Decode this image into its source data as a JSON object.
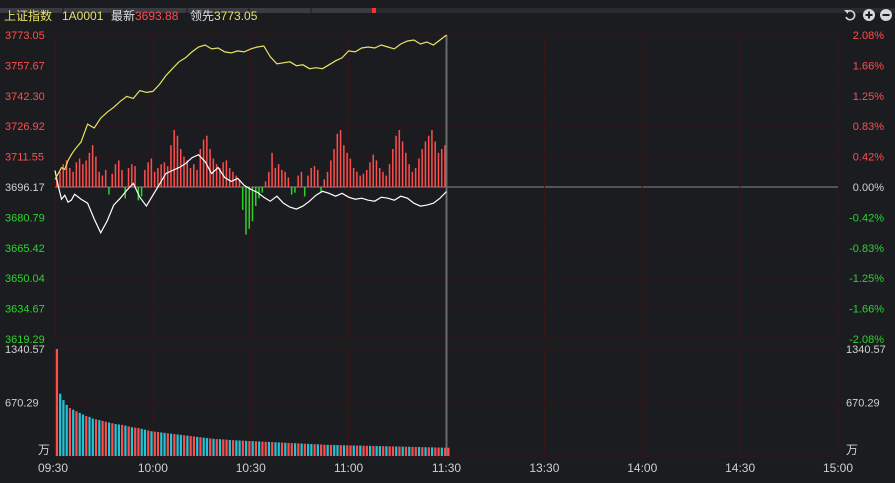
{
  "header": {
    "index_name": "上证指数",
    "code": "1A0001",
    "latest_label": "最新",
    "latest_value": "3693.88",
    "leading_label": "领先",
    "leading_value": "3773.05",
    "icons": [
      "undo-icon",
      "zoom-in-icon",
      "zoom-out-icon"
    ]
  },
  "colors": {
    "background": "#1b1c20",
    "grid": "#3a1414",
    "up": "#ff4d4d",
    "down": "#2bd42b",
    "index_line": "#ffffff",
    "leading_line": "#e9e265",
    "volume_bar": "#22c4d6",
    "axis_text_neutral": "#d0d0d0",
    "cursor_line": "#6a6a6a"
  },
  "chart_data": {
    "type": "line",
    "title": "",
    "prev_close": 3696.17,
    "ylim": [
      3619.29,
      3773.05
    ],
    "price_ticks": [
      "3773.05",
      "3757.67",
      "3742.30",
      "3726.92",
      "3711.55",
      "3696.17",
      "3680.79",
      "3665.42",
      "3650.04",
      "3634.67",
      "3619.29"
    ],
    "pct_ticks": [
      "2.08%",
      "1.66%",
      "1.25%",
      "0.83%",
      "0.42%",
      "0.00%",
      "-0.42%",
      "-0.83%",
      "-1.25%",
      "-1.66%",
      "-2.08%"
    ],
    "time_labels": [
      "09:30",
      "10:00",
      "10:30",
      "11:00",
      "11:30",
      "13:30",
      "14:00",
      "14:30",
      "15:00"
    ],
    "volume_ticks": [
      "1340.57",
      "670.29"
    ],
    "volume_unit": "万",
    "volume_max": 1340.57,
    "series": [
      {
        "key": "index",
        "x_minutes": [
          0,
          1,
          2,
          3,
          4,
          5,
          6,
          8,
          10,
          12,
          14,
          16,
          18,
          20,
          22,
          24,
          26,
          28,
          30,
          32,
          34,
          36,
          38,
          40,
          42,
          44,
          46,
          48,
          50,
          52,
          54,
          56,
          58,
          60,
          62,
          64,
          66,
          68,
          70,
          72,
          74,
          76,
          78,
          80,
          82,
          84,
          86,
          88,
          90,
          92,
          94,
          96,
          98,
          100,
          102,
          104,
          106,
          108,
          110,
          112,
          114,
          116,
          118,
          120
        ],
        "values": [
          3704.5,
          3696.5,
          3690.0,
          3692.0,
          3688.5,
          3689.5,
          3692.5,
          3690.0,
          3688.0,
          3680.0,
          3673.0,
          3679.0,
          3687.0,
          3690.5,
          3694.5,
          3698.0,
          3691.0,
          3686.5,
          3692.0,
          3697.5,
          3703.0,
          3704.5,
          3706.0,
          3708.0,
          3711.0,
          3712.5,
          3709.0,
          3703.0,
          3706.0,
          3701.0,
          3699.0,
          3700.5,
          3697.0,
          3695.0,
          3693.5,
          3691.0,
          3689.0,
          3691.5,
          3688.0,
          3686.0,
          3685.0,
          3686.5,
          3689.0,
          3692.0,
          3694.0,
          3693.0,
          3691.5,
          3693.0,
          3691.0,
          3690.0,
          3690.5,
          3689.5,
          3689.0,
          3691.0,
          3690.5,
          3689.5,
          3691.5,
          3690.5,
          3688.0,
          3686.5,
          3687.0,
          3688.0,
          3690.5,
          3693.9
        ]
      },
      {
        "key": "leading",
        "x_minutes": [
          0,
          1,
          2,
          3,
          4,
          5,
          6,
          8,
          10,
          12,
          14,
          16,
          18,
          20,
          22,
          24,
          26,
          28,
          30,
          32,
          34,
          36,
          38,
          40,
          42,
          44,
          46,
          48,
          50,
          52,
          54,
          56,
          58,
          60,
          62,
          64,
          66,
          68,
          70,
          72,
          74,
          76,
          78,
          80,
          82,
          84,
          86,
          88,
          90,
          92,
          94,
          96,
          98,
          100,
          102,
          104,
          106,
          108,
          110,
          112,
          114,
          116,
          118,
          120
        ],
        "values": [
          3700.0,
          3703.0,
          3706.0,
          3705.0,
          3709.5,
          3712.5,
          3715.0,
          3719.0,
          3728.0,
          3726.0,
          3731.0,
          3734.0,
          3736.5,
          3739.5,
          3742.0,
          3741.0,
          3745.0,
          3744.0,
          3744.5,
          3748.0,
          3752.5,
          3756.0,
          3759.5,
          3761.5,
          3764.5,
          3767.0,
          3768.0,
          3766.0,
          3766.5,
          3764.5,
          3764.0,
          3765.0,
          3764.5,
          3766.0,
          3767.0,
          3767.5,
          3762.0,
          3758.5,
          3759.0,
          3759.5,
          3757.5,
          3758.0,
          3756.0,
          3756.5,
          3756.0,
          3758.0,
          3760.0,
          3761.5,
          3765.0,
          3764.5,
          3766.5,
          3767.0,
          3766.5,
          3768.0,
          3767.0,
          3766.0,
          3768.5,
          3770.0,
          3770.5,
          3768.5,
          3769.5,
          3768.0,
          3770.5,
          3773.05
        ]
      }
    ],
    "diff_bars": [
      4,
      8,
      12,
      14,
      10,
      8,
      13,
      15,
      12,
      14,
      18,
      22,
      16,
      8,
      6,
      9,
      -4,
      7,
      12,
      14,
      9,
      -6,
      10,
      12,
      11,
      -7,
      -5,
      9,
      13,
      15,
      8,
      10,
      12,
      13,
      11,
      22,
      30,
      27,
      20,
      16,
      14,
      10,
      12,
      9,
      20,
      25,
      27,
      20,
      15,
      12,
      10,
      13,
      14,
      10,
      8,
      6,
      4,
      -12,
      -25,
      -22,
      -18,
      -10,
      -6,
      -3,
      3,
      8,
      18,
      10,
      12,
      9,
      8,
      5,
      -4,
      -3,
      6,
      8,
      -5,
      6,
      10,
      11,
      9,
      -3,
      4,
      8,
      14,
      20,
      28,
      30,
      22,
      18,
      15,
      10,
      8,
      6,
      7,
      9,
      13,
      17,
      14,
      10,
      8,
      6,
      12,
      20,
      27,
      30,
      24,
      18,
      12,
      8,
      10,
      15,
      20,
      24,
      27,
      30,
      24,
      18,
      20,
      22
    ],
    "volume": [
      1340.57,
      780,
      700,
      640,
      600,
      580,
      560,
      540,
      520,
      500,
      490,
      470,
      460,
      450,
      440,
      430,
      420,
      410,
      400,
      395,
      390,
      380,
      370,
      360,
      355,
      350,
      340,
      330,
      320,
      310,
      305,
      300,
      295,
      290,
      285,
      280,
      275,
      270,
      265,
      260,
      255,
      250,
      245,
      240,
      235,
      230,
      225,
      220,
      215,
      212,
      210,
      208,
      205,
      200,
      198,
      196,
      194,
      192,
      190,
      188,
      186,
      184,
      182,
      180,
      178,
      176,
      174,
      172,
      170,
      168,
      166,
      164,
      162,
      160,
      158,
      156,
      154,
      152,
      150,
      148,
      146,
      144,
      142,
      140,
      139,
      138,
      137,
      136,
      135,
      134,
      133,
      132,
      131,
      130,
      129,
      128,
      127,
      126,
      125,
      124,
      123,
      122,
      121,
      120,
      119,
      118,
      117,
      116,
      115,
      114,
      113,
      112,
      111,
      110,
      109,
      108,
      107,
      106,
      105,
      104,
      104
    ],
    "volume_up": [
      true,
      false,
      false,
      false,
      true,
      false,
      true,
      false,
      false,
      true,
      false,
      false,
      true,
      false,
      true,
      true,
      false,
      true,
      false,
      false,
      true,
      false,
      true,
      false,
      true,
      true,
      false,
      false,
      true,
      false,
      true,
      true,
      false,
      false,
      true,
      false,
      true,
      false,
      false,
      true,
      false,
      true,
      true,
      false,
      true,
      false,
      false,
      true,
      false,
      true,
      false,
      true,
      true,
      false,
      true,
      false,
      false,
      true,
      false,
      true,
      false,
      true,
      false,
      true,
      true,
      false,
      true,
      false,
      false,
      true,
      false,
      true,
      true,
      false,
      true,
      false,
      true,
      false,
      false,
      true,
      false,
      true,
      true,
      false,
      true,
      false,
      false,
      true,
      false,
      true,
      true,
      false,
      true,
      false,
      true,
      true,
      false,
      true,
      false,
      false,
      true,
      false,
      true,
      true,
      false,
      true,
      false,
      true,
      false,
      true,
      true,
      false,
      true,
      false,
      true,
      false,
      true,
      true,
      false,
      true,
      true
    ]
  }
}
